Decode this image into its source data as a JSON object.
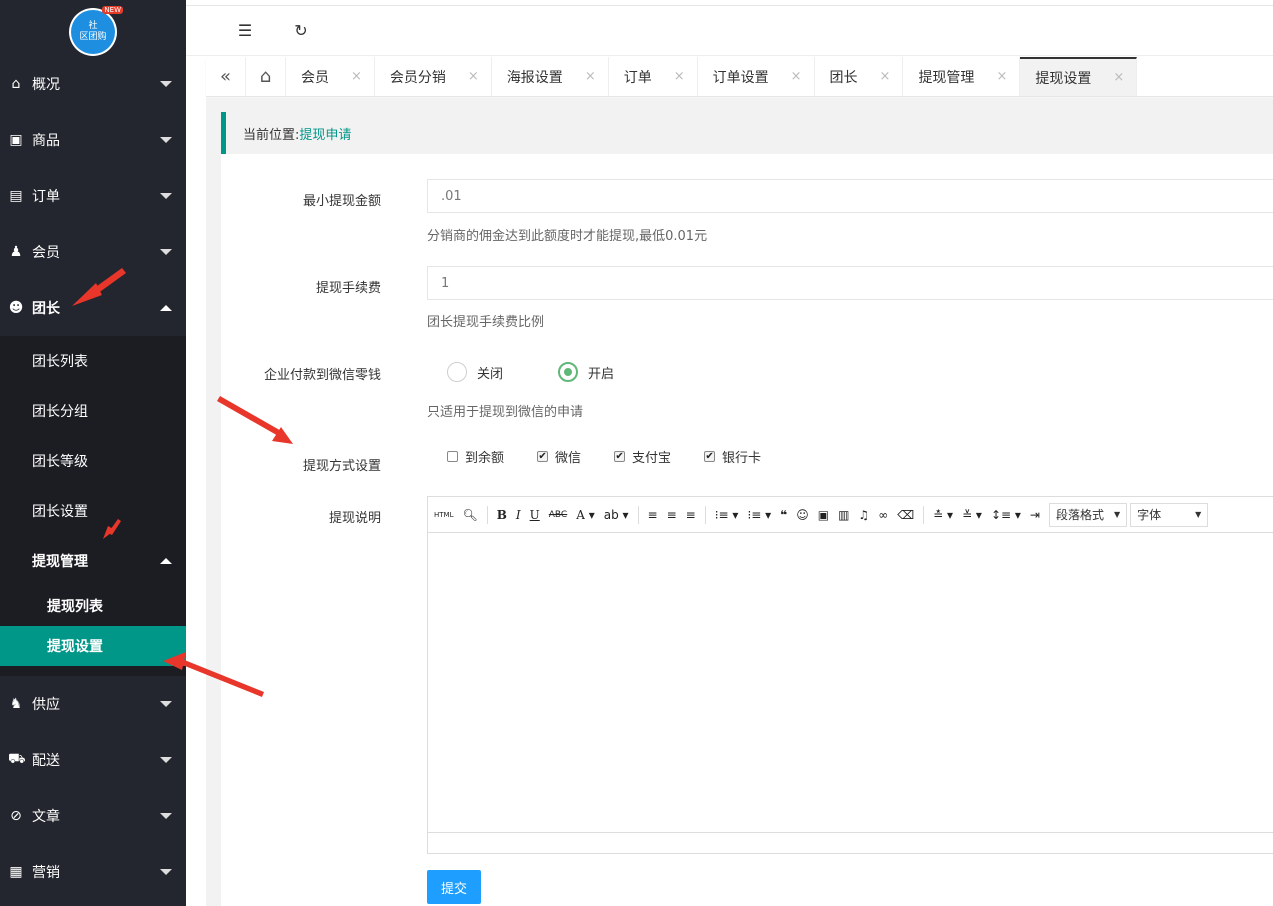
{
  "logo": {
    "line1": "社",
    "line2": "区团购",
    "badge": "NEW"
  },
  "sidebar": {
    "items": [
      {
        "label": "概况",
        "icon": "home-icon",
        "glyph": "⌂"
      },
      {
        "label": "商品",
        "icon": "shopping-bag-icon",
        "glyph": "▣"
      },
      {
        "label": "订单",
        "icon": "document-icon",
        "glyph": "▤"
      },
      {
        "label": "会员",
        "icon": "users-icon",
        "glyph": "♟"
      },
      {
        "label": "团长",
        "icon": "crown-icon",
        "glyph": "☻"
      }
    ],
    "sub_items": [
      {
        "label": "团长列表"
      },
      {
        "label": "团长分组"
      },
      {
        "label": "团长等级"
      },
      {
        "label": "团长设置"
      },
      {
        "label": "提现管理"
      }
    ],
    "subsub_items": [
      {
        "label": "提现列表"
      },
      {
        "label": "提现设置"
      }
    ],
    "bottom_items": [
      {
        "label": "供应",
        "icon": "supplier-icon",
        "glyph": "♞"
      },
      {
        "label": "配送",
        "icon": "truck-icon",
        "glyph": "⛟"
      },
      {
        "label": "文章",
        "icon": "compass-icon",
        "glyph": "⊘"
      },
      {
        "label": "营销",
        "icon": "gift-icon",
        "glyph": "▦"
      }
    ]
  },
  "topbar": {
    "collapse_glyph": "☰",
    "refresh_glyph": "↻"
  },
  "tabs": {
    "back_glyph": "«",
    "home_glyph": "⌂",
    "close_glyph": "×",
    "items": [
      {
        "label": "会员"
      },
      {
        "label": "会员分销"
      },
      {
        "label": "海报设置"
      },
      {
        "label": "订单"
      },
      {
        "label": "订单设置"
      },
      {
        "label": "团长"
      },
      {
        "label": "提现管理"
      },
      {
        "label": "提现设置"
      }
    ]
  },
  "breadcrumb": {
    "prefix": "当前位置:",
    "current": "提现申请"
  },
  "form": {
    "min_amount": {
      "label": "最小提现金额",
      "value": ".01",
      "help": "分销商的佣金达到此额度时才能提现,最低0.01元"
    },
    "fee": {
      "label": "提现手续费",
      "value": "1",
      "help": "团长提现手续费比例"
    },
    "wechat_pay": {
      "label": "企业付款到微信零钱",
      "off_label": "关闭",
      "on_label": "开启",
      "help": "只适用于提现到微信的申请"
    },
    "methods": {
      "label": "提现方式设置",
      "options": [
        {
          "label": "到余额",
          "checked": false
        },
        {
          "label": "微信",
          "checked": true
        },
        {
          "label": "支付宝",
          "checked": true
        },
        {
          "label": "银行卡",
          "checked": true
        }
      ]
    },
    "description": {
      "label": "提现说明"
    },
    "editor": {
      "html_label": "HTML",
      "paragraph_format": "段落格式",
      "font": "字体"
    },
    "submit_label": "提交"
  },
  "colors": {
    "accent": "#009688",
    "primary": "#1e9fff",
    "sidebar": "#23262e",
    "radio_on": "#5fb878"
  }
}
